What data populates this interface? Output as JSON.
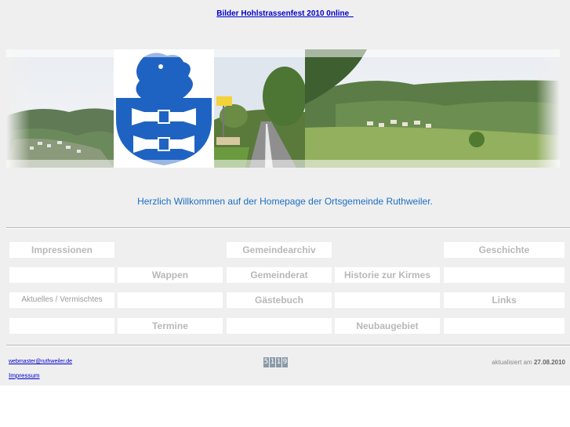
{
  "top_link": "Bilder Hohlstrassenfest 2010 0nline_",
  "welcome_text": "Herzlich Willkommen auf der Homepage der Ortsgemeinde Ruthweiler.",
  "nav": {
    "row1": [
      "Impressionen",
      "",
      "Gemeindearchiv",
      "",
      "Geschichte"
    ],
    "row2": [
      "",
      "Wappen",
      "Gemeinderat",
      "Historie zur Kirmes",
      ""
    ],
    "row3": [
      "Aktuelles / Vermischtes",
      "",
      "Gästebuch",
      "",
      "Links"
    ],
    "row4": [
      "",
      "Termine",
      "",
      "Neubaugebiet",
      ""
    ]
  },
  "footer": {
    "email": "webmaster@ruthweiler.de",
    "counter_digits": [
      "5",
      "1",
      "1",
      "9"
    ],
    "updated_label": "aktualisiert am",
    "updated_date": "27.08.2010",
    "impressum": "Impressum"
  },
  "colors": {
    "link": "#0000cc",
    "welcome": "#1a6fc4",
    "coat_of_arms_blue": "#1f63c2",
    "nav_text": "#b8b8b8"
  },
  "icons": [
    "coat-of-arms-lion-image",
    "town-sign-image",
    "landscape-image"
  ]
}
